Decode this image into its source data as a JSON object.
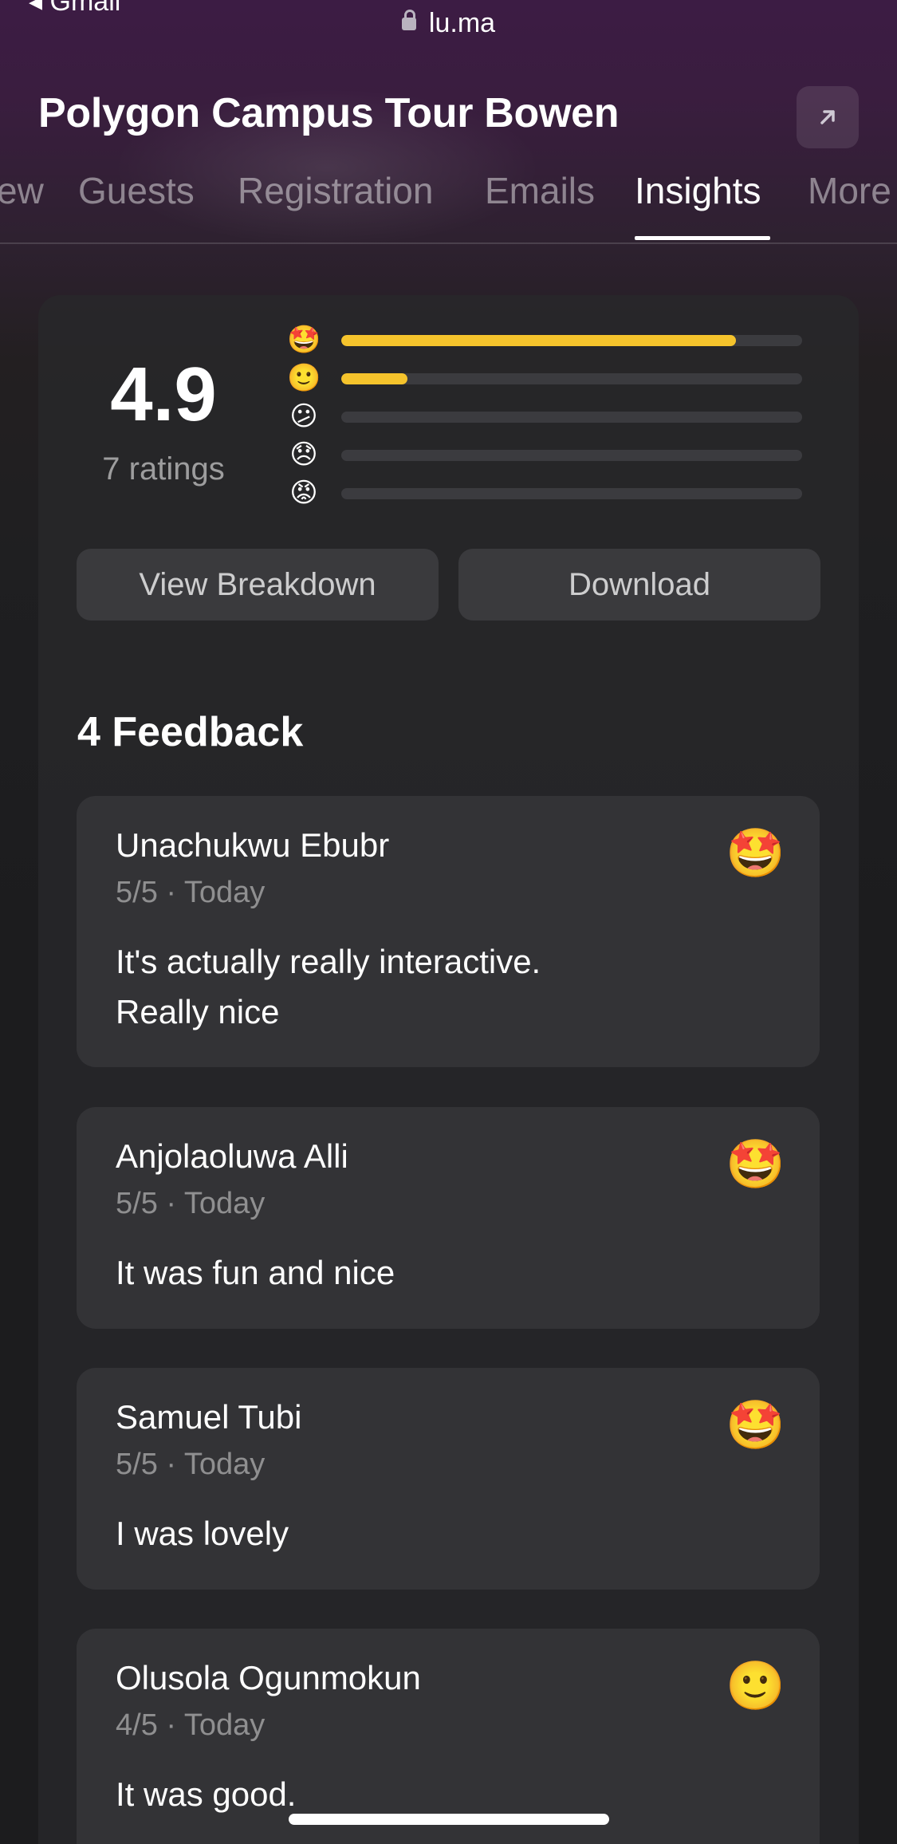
{
  "browser": {
    "back_label": "◂ Gmail",
    "url": "lu.ma"
  },
  "header": {
    "title": "Polygon Campus Tour Bowen",
    "share_icon": "arrow-up-right-icon"
  },
  "tabs": [
    {
      "label": "ew",
      "active": false
    },
    {
      "label": "Guests",
      "active": false
    },
    {
      "label": "Registration",
      "active": false
    },
    {
      "label": "Emails",
      "active": false
    },
    {
      "label": "Insights",
      "active": true
    },
    {
      "label": "More",
      "active": false
    }
  ],
  "summary": {
    "average": "4.9",
    "count_label": "7 ratings",
    "distribution": [
      {
        "emoji": "🤩",
        "icon": "star-struck-face-icon",
        "fraction": 0.857
      },
      {
        "emoji": "🙂",
        "icon": "slightly-smiling-face-icon",
        "fraction": 0.143
      },
      {
        "emoji": "😕",
        "icon": "confused-face-icon",
        "fraction": 0
      },
      {
        "emoji": "😞",
        "icon": "disappointed-face-icon",
        "fraction": 0
      },
      {
        "emoji": "😡",
        "icon": "angry-face-icon",
        "fraction": 0
      }
    ],
    "bar_color": "#f5c32c"
  },
  "actions": {
    "view_breakdown": "View Breakdown",
    "download": "Download"
  },
  "feedback": {
    "heading": "4 Feedback",
    "items": [
      {
        "name": "Unachukwu Ebubr",
        "meta": "5/5 · Today",
        "text": "It's actually really interactive.\nReally nice",
        "emoji": "🤩"
      },
      {
        "name": "Anjolaoluwa Alli",
        "meta": "5/5 · Today",
        "text": "It was fun and nice",
        "emoji": "🤩"
      },
      {
        "name": "Samuel Tubi",
        "meta": "5/5 · Today",
        "text": "I was lovely",
        "emoji": "🤩"
      },
      {
        "name": "Olusola Ogunmokun",
        "meta": "4/5 · Today",
        "text": "It was good.",
        "emoji": "🙂"
      }
    ]
  }
}
